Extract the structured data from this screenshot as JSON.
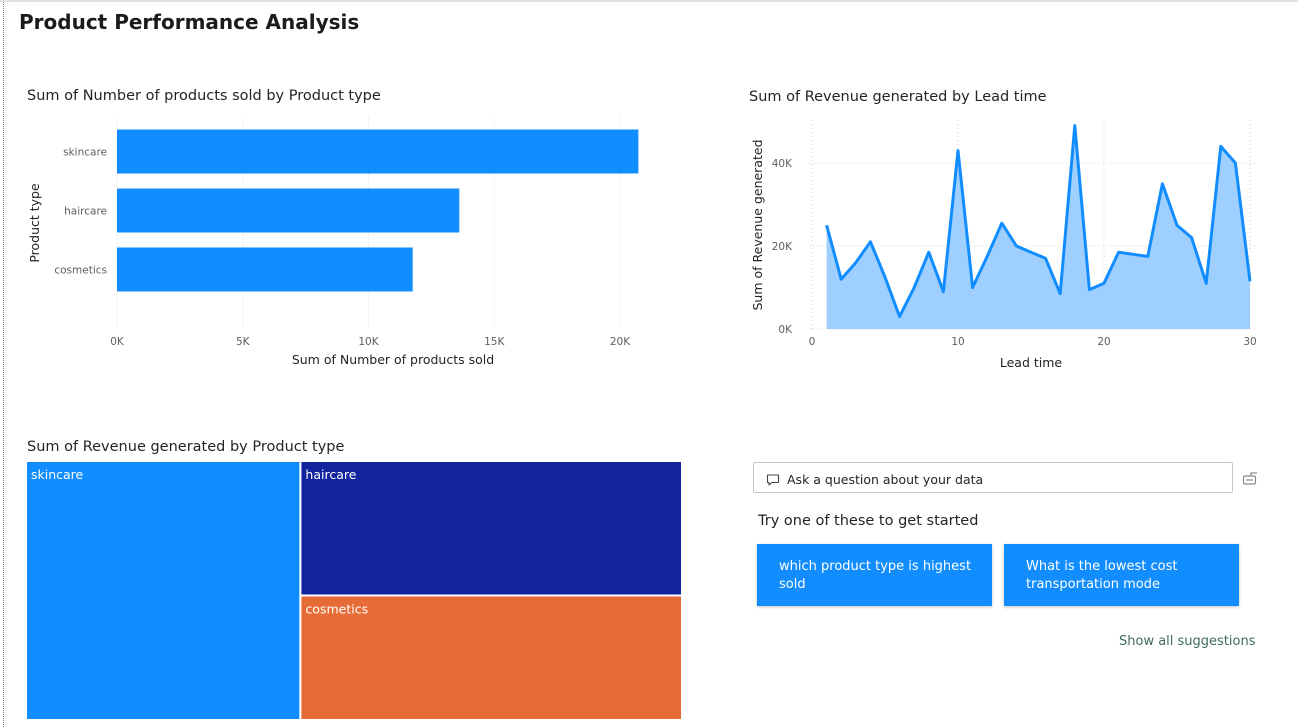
{
  "page": {
    "title": "Product Performance Analysis"
  },
  "bar_chart": {
    "title": "Sum of Number of products sold by Product type",
    "xlabel": "Sum of Number of products sold",
    "ylabel": "Product type",
    "ticks": [
      "0K",
      "5K",
      "10K",
      "15K",
      "20K"
    ],
    "color": "#118dff"
  },
  "line_chart": {
    "title": "Sum of Revenue generated by Lead time",
    "xlabel": "Lead time",
    "ylabel": "Sum of Revenue generated",
    "yticks": [
      "0K",
      "20K",
      "40K"
    ],
    "xticks": [
      "0",
      "10",
      "20",
      "30"
    ],
    "line_color": "#118dff",
    "fill_color": "#9fcfff"
  },
  "treemap": {
    "title": "Sum of Revenue generated by Product type",
    "items": [
      {
        "label": "skincare",
        "color": "#118dff"
      },
      {
        "label": "haircare",
        "color": "#12239e"
      },
      {
        "label": "cosmetics",
        "color": "#e66c37"
      }
    ]
  },
  "qna": {
    "placeholder": "Ask a question about your data",
    "hint": "Try one of these to get started",
    "suggestions": [
      "which product type is highest sold",
      "What is the lowest cost transportation mode"
    ],
    "show_all": "Show all suggestions"
  },
  "chart_data": [
    {
      "type": "bar",
      "title": "Sum of Number of products sold by Product type",
      "xlabel": "Sum of Number of products sold",
      "ylabel": "Product type",
      "categories": [
        "skincare",
        "haircare",
        "cosmetics"
      ],
      "values": [
        20731,
        13611,
        11757
      ],
      "xlim": [
        0,
        20000
      ],
      "orientation": "horizontal",
      "grid": "vertical-dotted"
    },
    {
      "type": "area",
      "title": "Sum of Revenue generated by Lead time",
      "xlabel": "Lead time",
      "ylabel": "Sum of Revenue generated",
      "x": [
        1,
        2,
        3,
        4,
        5,
        6,
        7,
        8,
        9,
        10,
        11,
        12,
        13,
        14,
        15,
        16,
        17,
        18,
        19,
        20,
        21,
        22,
        23,
        24,
        25,
        26,
        27,
        28,
        29,
        30
      ],
      "values": [
        25000,
        12000,
        16000,
        21000,
        12500,
        3000,
        10000,
        18500,
        9000,
        43000,
        10000,
        17500,
        25500,
        20000,
        18500,
        17000,
        8500,
        49000,
        9500,
        11000,
        18500,
        18000,
        17500,
        35000,
        25000,
        22000,
        11000,
        44000,
        40000,
        11500
      ],
      "xlim": [
        0,
        30
      ],
      "ylim": [
        0,
        40000
      ],
      "grid": "dotted"
    },
    {
      "type": "treemap",
      "title": "Sum of Revenue generated by Product type",
      "categories": [
        "skincare",
        "haircare",
        "cosmetics"
      ],
      "values": [
        241628,
        174455,
        161521
      ]
    }
  ]
}
